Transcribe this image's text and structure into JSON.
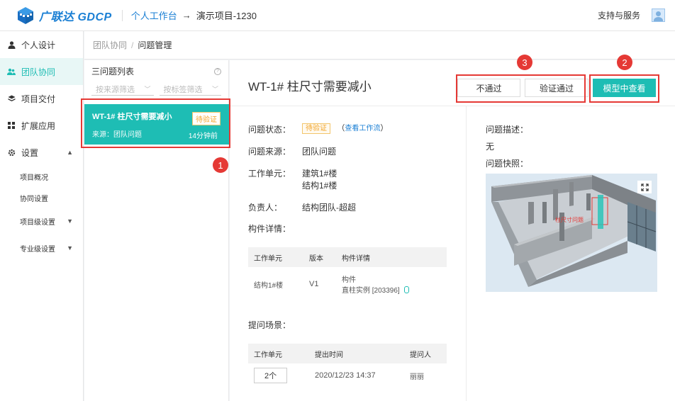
{
  "header": {
    "logo_text": "广联达 GDCP",
    "crumb_link": "个人工作台",
    "crumb_arrow": "→",
    "project": "演示项目-1230",
    "support": "支持与服务"
  },
  "sidebar": {
    "items": [
      {
        "label": "个人设计"
      },
      {
        "label": "团队协同",
        "active": true
      },
      {
        "label": "项目交付"
      },
      {
        "label": "扩展应用"
      },
      {
        "label": "设置"
      }
    ],
    "sub_items": [
      {
        "label": "项目概况"
      },
      {
        "label": "协同设置"
      },
      {
        "label": "项目级设置"
      },
      {
        "label": "专业级设置"
      }
    ]
  },
  "breadcrumb": {
    "parent": "团队协同",
    "sep": "/",
    "current": "问题管理"
  },
  "list": {
    "title": "三问题列表",
    "filter_source": "按来源筛选",
    "filter_tag": "按标签筛选",
    "card": {
      "title": "WT-1# 柱尺寸需要减小",
      "source": "来源：团队问题",
      "badge": "待验证",
      "time": "14分钟前"
    }
  },
  "detail": {
    "title": "WT-1# 柱尺寸需要减小",
    "btn_reject": "不通过",
    "btn_verify": "验证通过",
    "btn_model": "模型中查看",
    "status_label": "问题状态：",
    "status_value": "待验证",
    "workflow_open": "（",
    "workflow_link": "查看工作流",
    "workflow_close": "）",
    "source_label": "问题来源：",
    "source_value": "团队问题",
    "unit_label": "工作单元：",
    "unit_values": [
      "建筑1#楼",
      "结构1#楼"
    ],
    "owner_label": "负责人：",
    "owner_value": "结构团队-超超",
    "comp_label": "构件详情：",
    "comp_table": {
      "headers": [
        "工作单元",
        "版本",
        "构件详情"
      ],
      "row": {
        "unit": "结构1#楼",
        "version": "V1",
        "detail_1": "构件",
        "detail_2": "直柱实例 [203396]"
      }
    },
    "scene_label": "提问场景：",
    "scene_table": {
      "headers": [
        "工作单元",
        "提出时间",
        "提问人"
      ],
      "row": {
        "unit": "2个",
        "time": "2020/12/23 14:37",
        "person": "丽丽"
      }
    },
    "desc_label": "问题描述：",
    "desc_value": "无",
    "snapshot_label": "问题快照：",
    "snapshot_tag": "柱尺寸问题"
  },
  "markers": [
    "1",
    "2",
    "3"
  ],
  "colors": {
    "accent": "#1ebdb4",
    "brand": "#1a7fd4",
    "warn": "#f2a52b",
    "marker": "#e53935"
  }
}
